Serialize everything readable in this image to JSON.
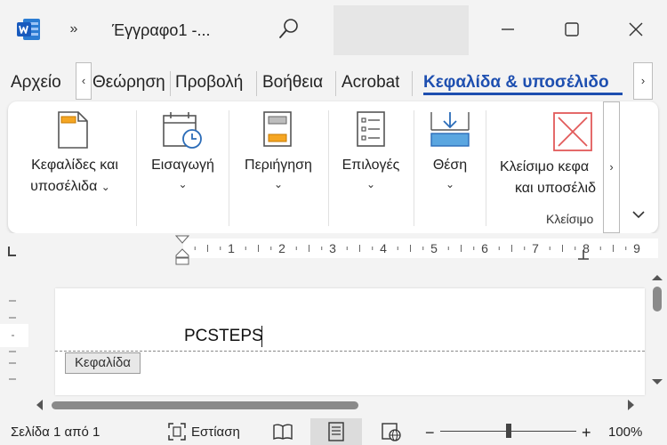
{
  "titlebar": {
    "doc_title": "Έγγραφο1  -...",
    "more_glyph": "»"
  },
  "tabs": {
    "items": [
      {
        "label": "Αρχείο"
      },
      {
        "label": "Θεώρηση"
      },
      {
        "label": "Προβολή"
      },
      {
        "label": "Βοήθεια"
      },
      {
        "label": "Acrobat"
      },
      {
        "label": "Κεφαλίδα & υποσέλιδο"
      }
    ],
    "active_color": "#1e4fb0",
    "scroll_left": "‹",
    "scroll_right": "›"
  },
  "ribbon": {
    "groups": [
      {
        "label_line1": "Κεφαλίδες και",
        "label_line2": "υποσέλιδα",
        "icon": "header-footer-icon"
      },
      {
        "label_line1": "Εισαγωγή",
        "icon": "insert-date-time-icon"
      },
      {
        "label_line1": "Περιήγηση",
        "icon": "navigation-icon"
      },
      {
        "label_line1": "Επιλογές",
        "icon": "options-icon"
      },
      {
        "label_line1": "Θέση",
        "icon": "position-icon"
      },
      {
        "label_line1": "Κλείσιμο κεφα",
        "label_line2": "και υποσέλιδ",
        "icon": "close-header-footer-icon"
      }
    ],
    "close_group_title": "Κλείσιμο",
    "scroll_right": "›",
    "collapse_glyph": "⌄",
    "dropdown_glyph": "⌄",
    "close_color": "#e25a5a"
  },
  "ruler": {
    "numbers": [
      "1",
      "2",
      "3",
      "4",
      "5",
      "6",
      "7",
      "8",
      "9"
    ]
  },
  "document": {
    "header_text": "PCSTEPS",
    "header_tag": "Κεφαλίδα"
  },
  "statusbar": {
    "page_info": "Σελίδα 1 από 1",
    "focus_label": "Εστίαση",
    "zoom": "100%",
    "zoom_slider_level": 0.5
  }
}
